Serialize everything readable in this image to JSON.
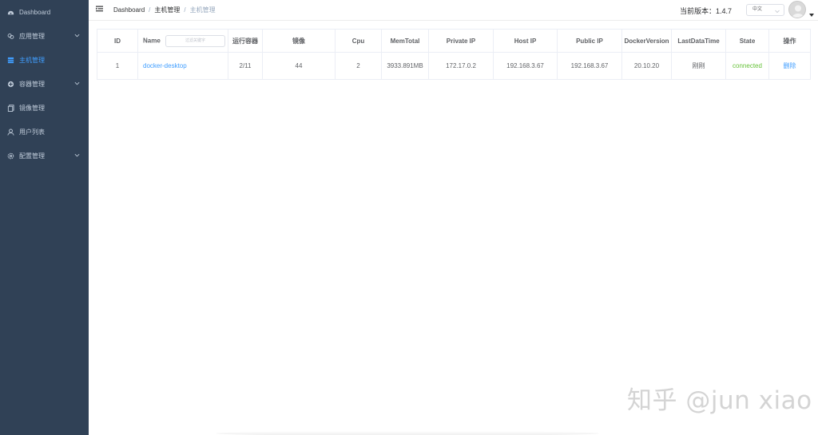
{
  "sidebar": {
    "items": [
      {
        "label": "Dashboard",
        "icon": "dashboard-icon",
        "active": false,
        "expandable": false
      },
      {
        "label": "应用管理",
        "icon": "application-icon",
        "active": false,
        "expandable": true
      },
      {
        "label": "主机管理",
        "icon": "host-icon",
        "active": true,
        "expandable": false
      },
      {
        "label": "容器管理",
        "icon": "container-icon",
        "active": false,
        "expandable": true
      },
      {
        "label": "镜像管理",
        "icon": "image-icon",
        "active": false,
        "expandable": false
      },
      {
        "label": "用户列表",
        "icon": "user-icon",
        "active": false,
        "expandable": false
      },
      {
        "label": "配置管理",
        "icon": "settings-icon",
        "active": false,
        "expandable": true
      }
    ],
    "colors": {
      "bg": "#304156",
      "text": "#bfcbd9",
      "active": "#409eff"
    }
  },
  "header": {
    "breadcrumb": [
      "Dashboard",
      "主机管理",
      "主机管理"
    ],
    "version": "当前版本：1.4.7",
    "language": "中文"
  },
  "table": {
    "columns": {
      "id": "ID",
      "name": "Name",
      "running": "运行容器",
      "images": "镜像",
      "cpu": "Cpu",
      "mem": "MemTotal",
      "private_ip": "Private IP",
      "host_ip": "Host IP",
      "public_ip": "Public IP",
      "docker_version": "DockerVersion",
      "last_time": "LastDataTime",
      "state": "State",
      "action": "操作"
    },
    "filter_placeholder": "过滤关键字",
    "rows": [
      {
        "id": "1",
        "name": "docker-desktop",
        "running": "2/11",
        "images": "44",
        "cpu": "2",
        "mem": "3933.891MB",
        "private_ip": "172.17.0.2",
        "host_ip": "192.168.3.67",
        "public_ip": "192.168.3.67",
        "docker_version": "20.10.20",
        "last_time": "刚刚",
        "state": "connected",
        "action": "删除"
      }
    ]
  },
  "watermark": "知乎 @jun xiao"
}
